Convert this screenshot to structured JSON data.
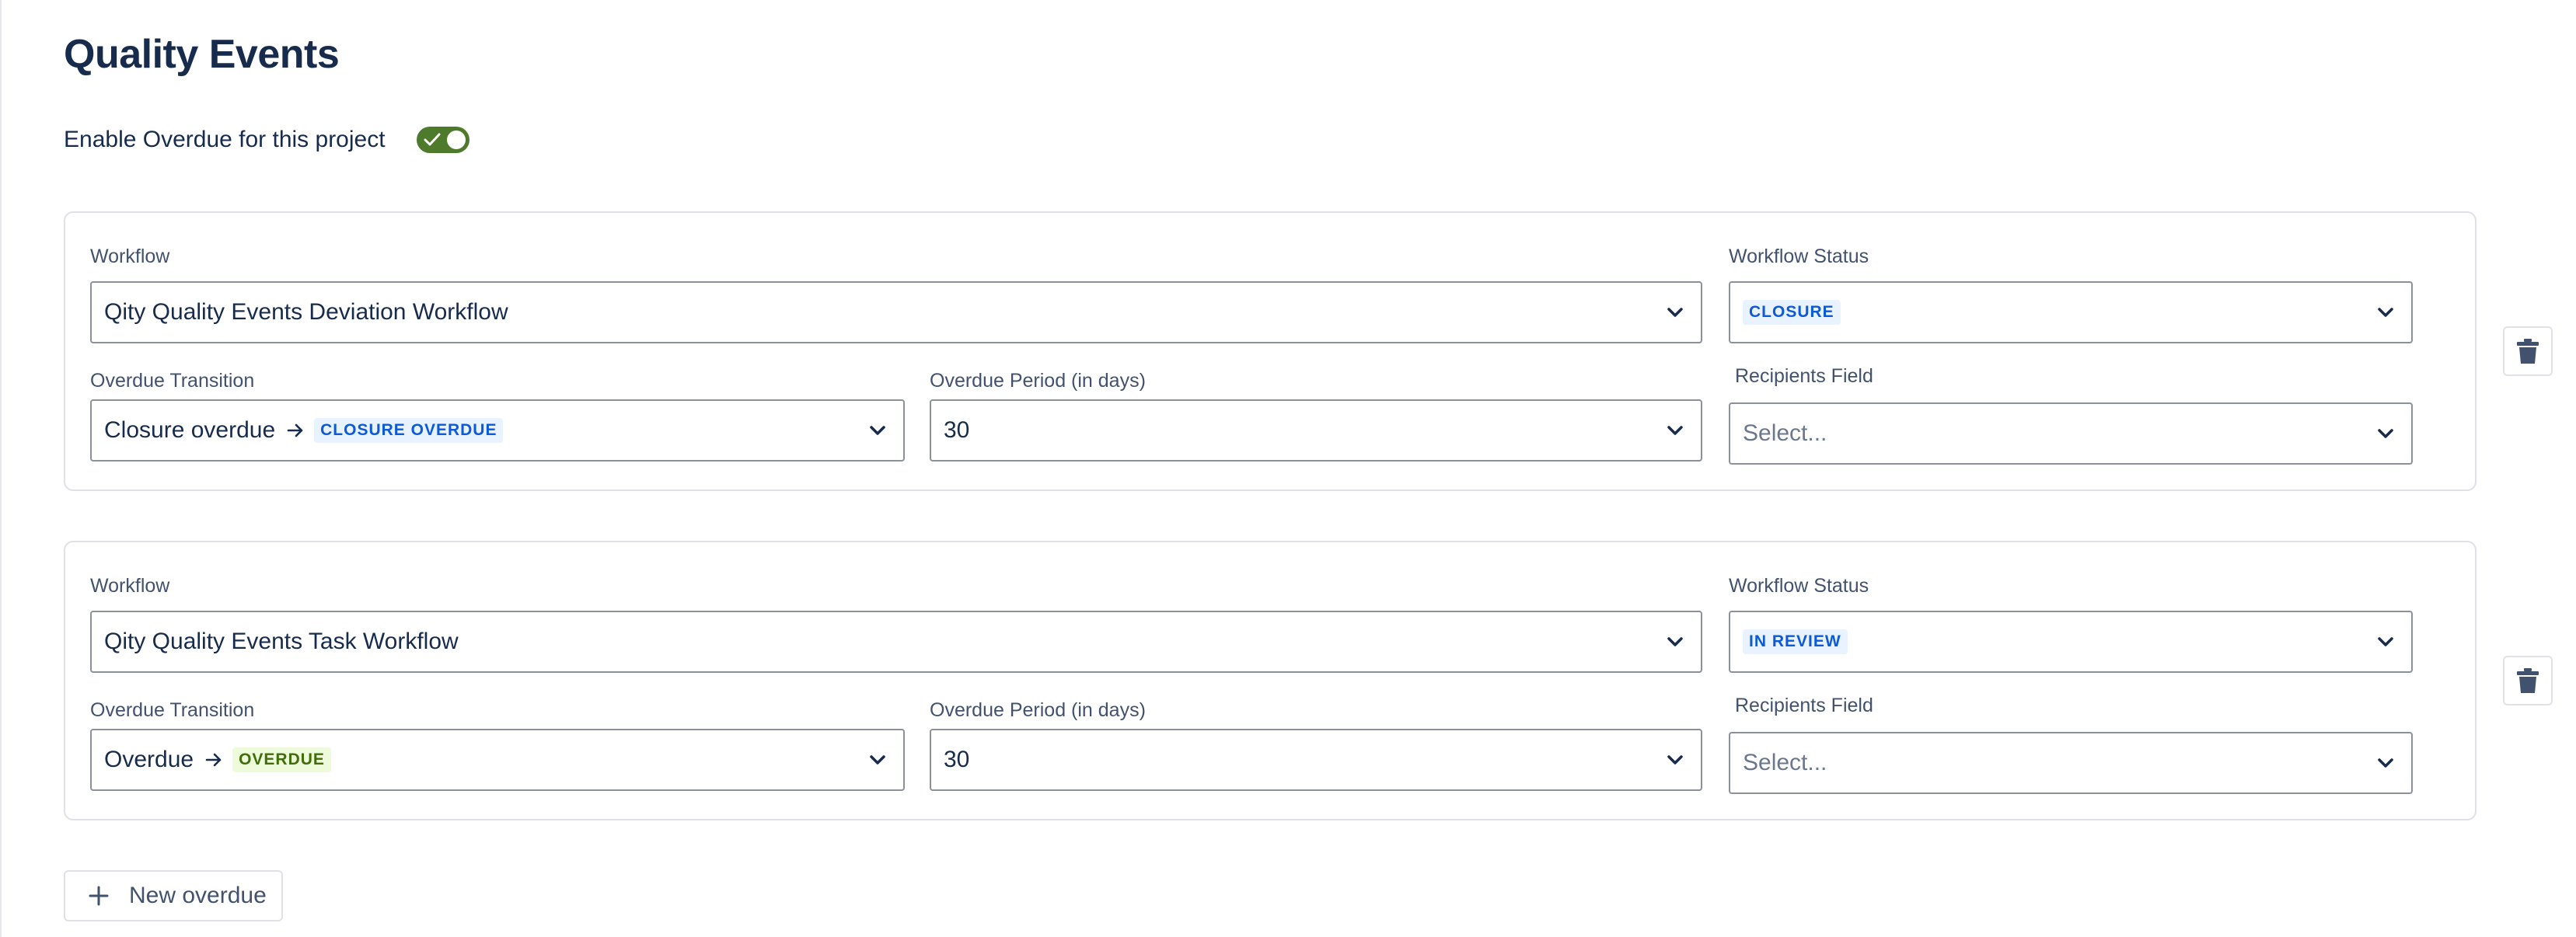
{
  "page": {
    "title": "Quality Events"
  },
  "overdue_toggle": {
    "label": "Enable Overdue for this project",
    "enabled": true,
    "color": "#4e7a2b"
  },
  "labels": {
    "workflow": "Workflow",
    "workflow_status": "Workflow Status",
    "overdue_transition": "Overdue Transition",
    "overdue_period": "Overdue Period (in days)",
    "recipients_field": "Recipients Field"
  },
  "rules": [
    {
      "workflow": "Qity Quality Events Deviation Workflow",
      "workflow_status": {
        "text": "CLOSURE",
        "color": "blue"
      },
      "overdue_transition": {
        "name": "Closure overdue",
        "target": "CLOSURE OVERDUE",
        "target_color": "blue"
      },
      "overdue_period": "30",
      "recipients_field": {
        "value": "",
        "placeholder": "Select..."
      }
    },
    {
      "workflow": "Qity Quality Events Task Workflow",
      "workflow_status": {
        "text": "IN REVIEW",
        "color": "blue"
      },
      "overdue_transition": {
        "name": "Overdue",
        "target": "OVERDUE",
        "target_color": "green"
      },
      "overdue_period": "30",
      "recipients_field": {
        "value": "",
        "placeholder": "Select..."
      }
    }
  ],
  "new_overdue_button": {
    "label": "New overdue"
  },
  "icons": {
    "toggle": "check-icon",
    "dropdown": "chevron-down-icon",
    "transition": "arrow-right-icon",
    "delete": "trash-icon",
    "add": "plus-icon"
  },
  "colors": {
    "lozenge_blue_bg": "#e9f2ff",
    "lozenge_blue_text": "#0c5ad6",
    "lozenge_green_bg": "#eefbda",
    "lozenge_green_text": "#3f6e0a"
  }
}
